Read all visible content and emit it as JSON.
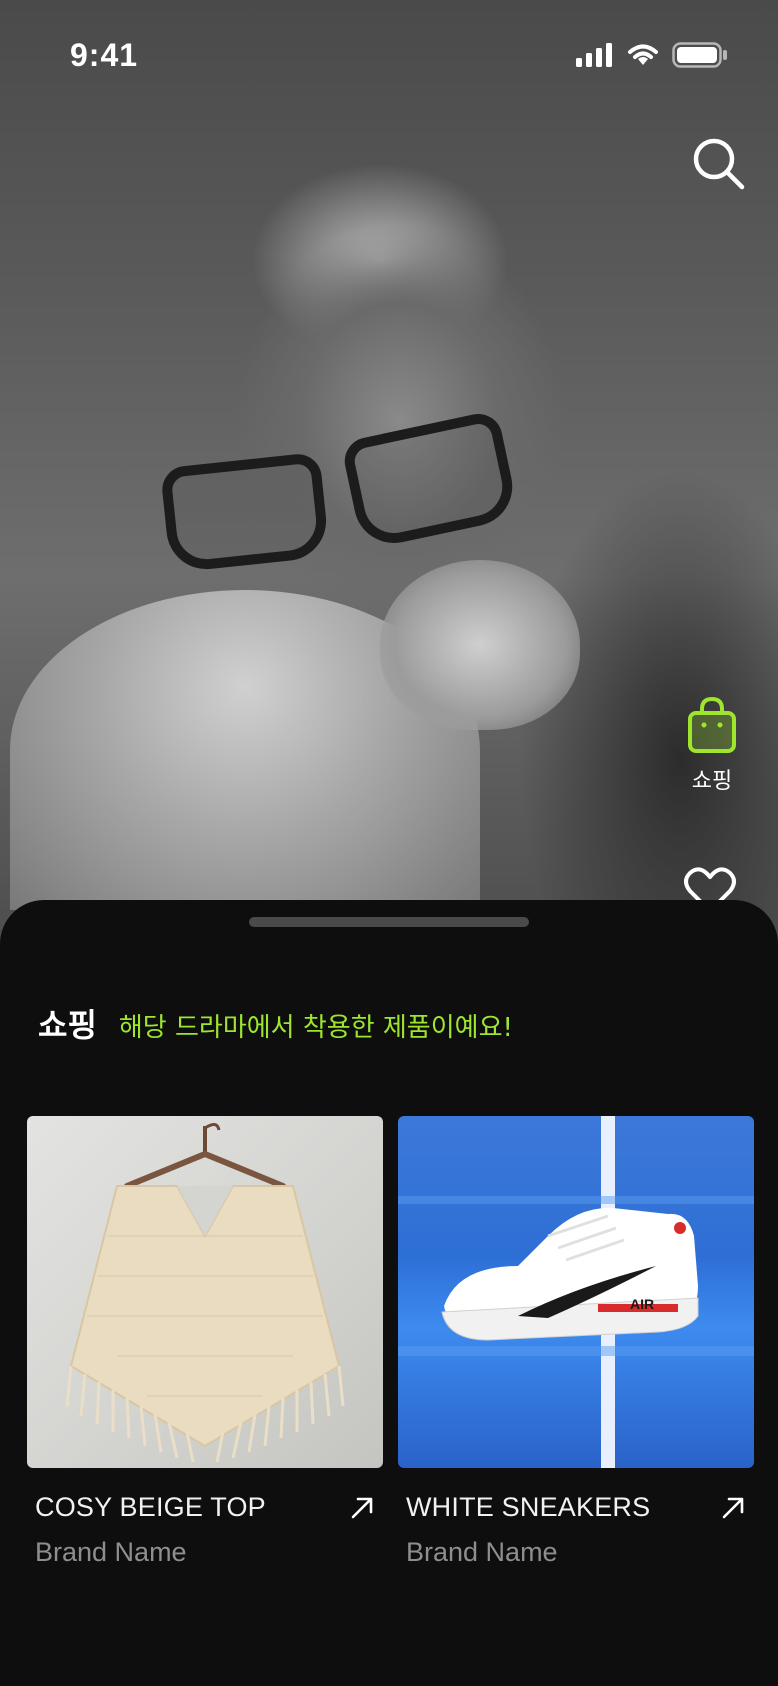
{
  "status_bar": {
    "time": "9:41",
    "icons": [
      "cellular-signal-icon",
      "wifi-icon",
      "battery-icon"
    ]
  },
  "top_actions": {
    "search_icon": "search-icon"
  },
  "side_actions": {
    "shopping_label": "쇼핑",
    "shopping_icon": "shopping-bag-icon",
    "like_icon": "heart-icon"
  },
  "sheet": {
    "title": "쇼핑",
    "subtitle": "해당 드라마에서 착용한 제품이예요!",
    "products": [
      {
        "name": "COSY BEIGE TOP",
        "brand": "Brand Name",
        "image": "beige crochet poncho on hanger"
      },
      {
        "name": "WHITE SNEAKERS",
        "brand": "Brand Name",
        "image": "white Nike Air sneaker on blue court"
      }
    ]
  },
  "colors": {
    "accent": "#9EE62D",
    "sheet_bg": "#0E0E0E",
    "text_primary": "#F2F2F2",
    "text_secondary": "#8E8E8E"
  }
}
